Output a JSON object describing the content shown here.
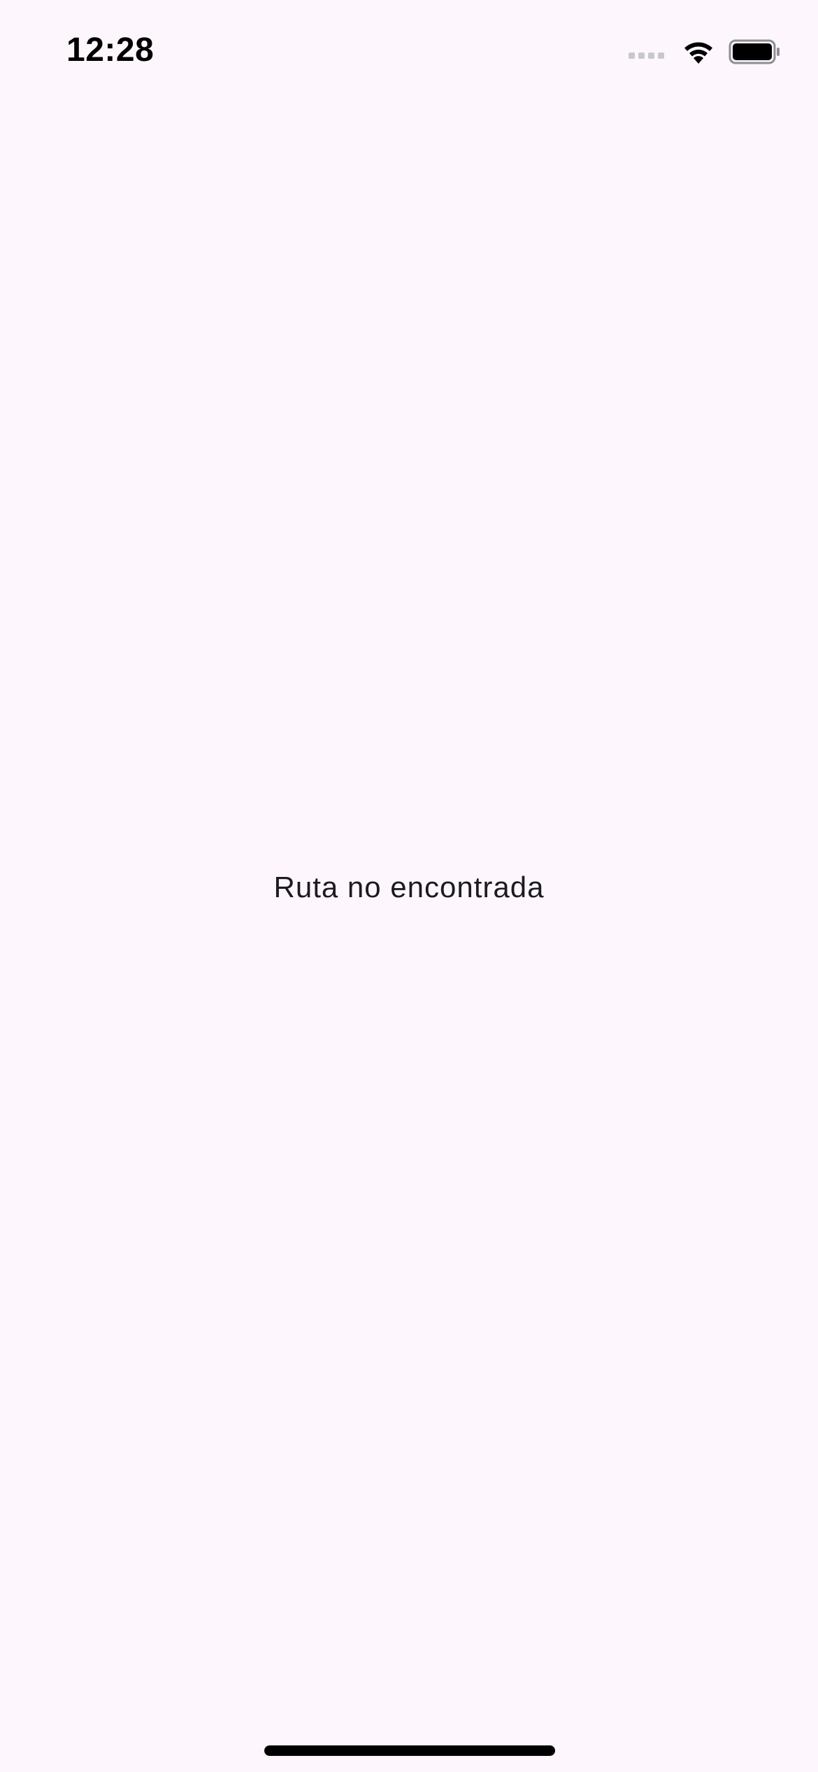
{
  "status_bar": {
    "time": "12:28",
    "signal_icon": "cellular-signal-icon",
    "wifi_icon": "wifi-icon",
    "battery_icon": "battery-icon",
    "battery_level": 1.0
  },
  "main": {
    "message": "Ruta no encontrada"
  },
  "colors": {
    "background": "#fdf7fd",
    "text": "#1c1b1f",
    "home_indicator": "#000000"
  }
}
